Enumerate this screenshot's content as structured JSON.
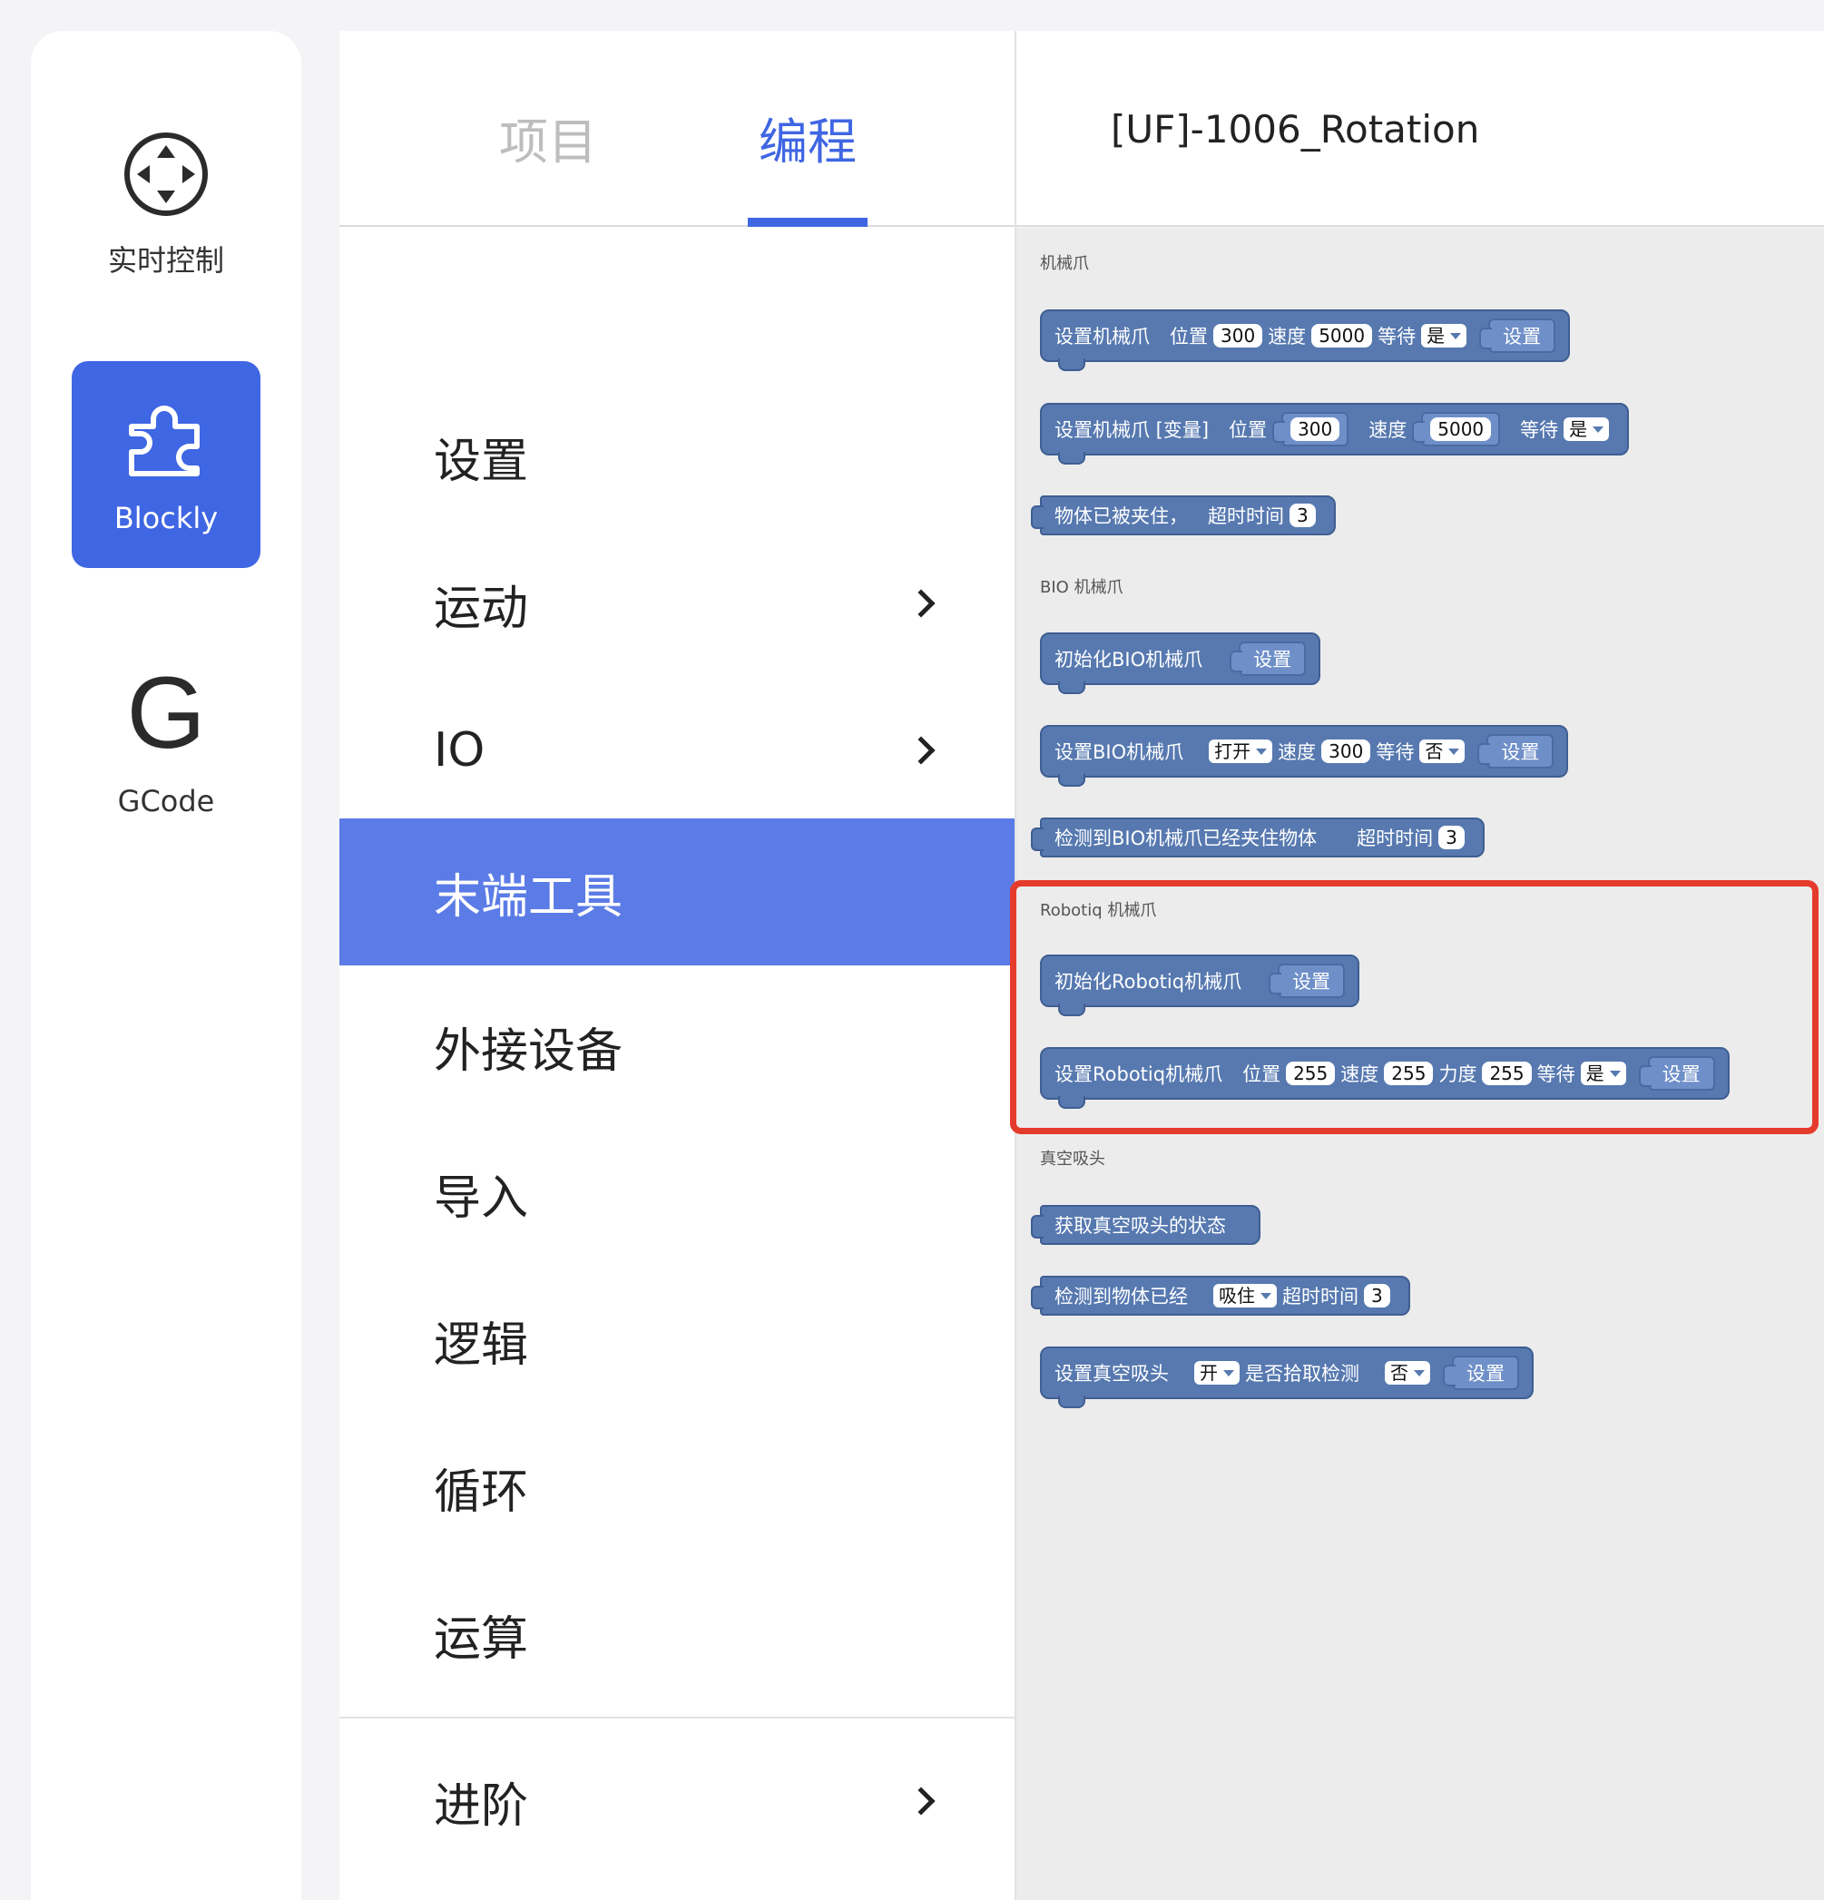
{
  "rail": {
    "items": [
      {
        "label": "实时控制",
        "icon": "move-arrows-icon"
      },
      {
        "label": "Blockly",
        "icon": "puzzle-icon"
      },
      {
        "label": "GCode",
        "icon": "g-letter-icon",
        "glyph": "G"
      }
    ]
  },
  "tabs": [
    {
      "label": "项目"
    },
    {
      "label": "编程"
    }
  ],
  "categories": [
    {
      "label": "设置"
    },
    {
      "label": "运动"
    },
    {
      "label": "IO"
    },
    {
      "label": "末端工具"
    },
    {
      "label": "外接设备"
    },
    {
      "label": "导入"
    },
    {
      "label": "逻辑"
    },
    {
      "label": "循环"
    },
    {
      "label": "运算"
    },
    {
      "label": "进阶"
    }
  ],
  "project": {
    "title": "[UF]-1006_Rotation"
  },
  "colors": {
    "accent": "#3f66e3",
    "block": "#5779b0",
    "highlight": "#e53b2c"
  },
  "sections": {
    "gripper": "机械爪",
    "bio": "BIO 机械爪",
    "robotiq": "Robotiq 机械爪",
    "vacuum": "真空吸头"
  },
  "blocks": {
    "set_gripper": {
      "label": "设置机械爪",
      "pos_label": "位置",
      "pos": "300",
      "speed_label": "速度",
      "speed": "5000",
      "wait_label": "等待",
      "wait": "是",
      "set": "设置"
    },
    "set_gripper_var": {
      "label": "设置机械爪 [变量]",
      "pos_label": "位置",
      "pos": "300",
      "speed_label": "速度",
      "speed": "5000",
      "wait_label": "等待",
      "wait": "是"
    },
    "object_gripped": {
      "label": "物体已被夹住，",
      "timeout_label": "超时时间",
      "timeout": "3"
    },
    "init_bio": {
      "label": "初始化BIO机械爪",
      "set": "设置"
    },
    "set_bio": {
      "label": "设置BIO机械爪",
      "state": "打开",
      "speed_label": "速度",
      "speed": "300",
      "wait_label": "等待",
      "wait": "否",
      "set": "设置"
    },
    "detect_bio": {
      "label": "检测到BIO机械爪已经夹住物体",
      "timeout_label": "超时时间",
      "timeout": "3"
    },
    "init_robotiq": {
      "label": "初始化Robotiq机械爪",
      "set": "设置"
    },
    "set_robotiq": {
      "label": "设置Robotiq机械爪",
      "pos_label": "位置",
      "pos": "255",
      "speed_label": "速度",
      "speed": "255",
      "force_label": "力度",
      "force": "255",
      "wait_label": "等待",
      "wait": "是",
      "set": "设置"
    },
    "get_vacuum": {
      "label": "获取真空吸头的状态"
    },
    "detect_vacuum": {
      "label": "检测到物体已经",
      "state": "吸住",
      "timeout_label": "超时时间",
      "timeout": "3"
    },
    "set_vacuum": {
      "label": "设置真空吸头",
      "state": "开",
      "check_label": "是否拾取检测",
      "check": "否",
      "set": "设置"
    }
  }
}
